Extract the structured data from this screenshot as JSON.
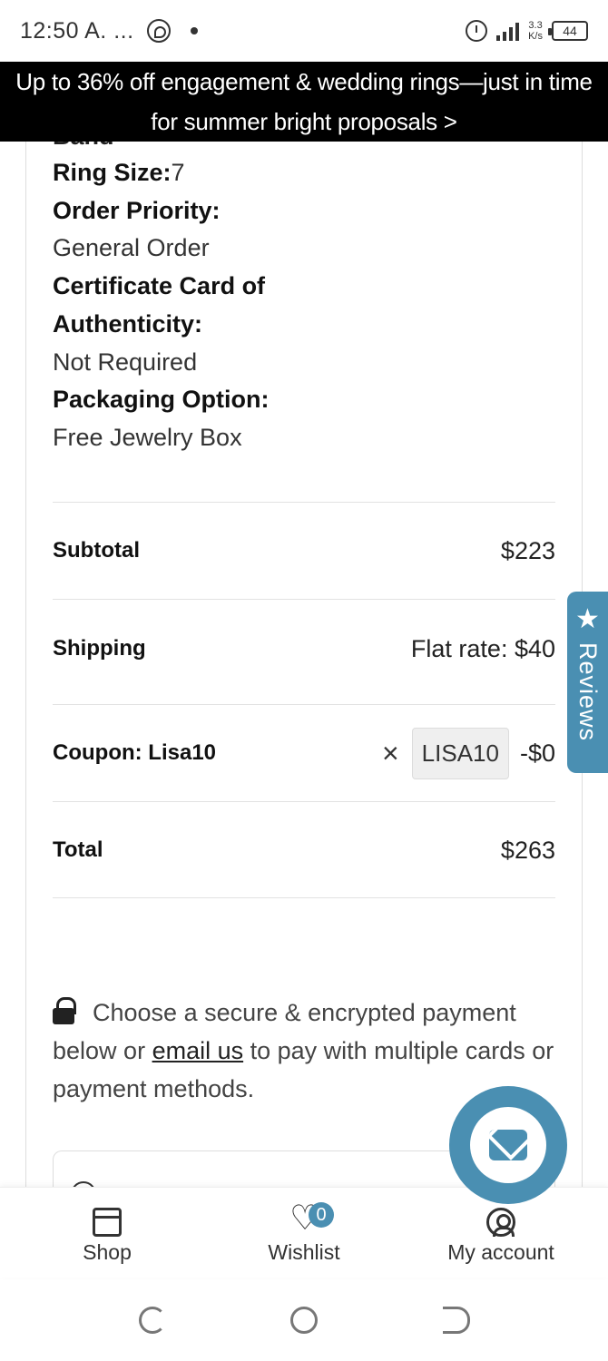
{
  "status_bar": {
    "time": "12:50 A. ...",
    "speed_value": "3.3",
    "speed_unit": "K/s",
    "battery": "44"
  },
  "promo": {
    "text": "Up to 36% off engagement & wedding rings—just in time for summer bright proposals >"
  },
  "order_details": {
    "clipped_text": "Band",
    "ring_size_label": "Ring Size:",
    "ring_size_value": "7",
    "priority_label": "Order Priority:",
    "priority_value": "General Order",
    "certificate_label": "Certificate Card of Authenticity:",
    "certificate_value": "Not Required",
    "packaging_label": "Packaging Option:",
    "packaging_value": "Free Jewelry Box"
  },
  "totals": {
    "subtotal_label": "Subtotal",
    "subtotal_value": "$223",
    "shipping_label": "Shipping",
    "shipping_value": "Flat rate: $40",
    "coupon_label": "Coupon: Lisa10",
    "coupon_remove": "×",
    "coupon_code": "LISA10",
    "coupon_value": "-$0",
    "total_label": "Total",
    "total_value": "$263"
  },
  "secure_note": {
    "text_before": "Choose a secure & encrypted payment below or ",
    "link": "email us",
    "text_after": " to pay with multiple cards or payment methods."
  },
  "reviews_tab": {
    "label": "Reviews",
    "icon": "star-icon"
  },
  "chat_button": {
    "icon": "envelope-icon"
  },
  "bottom_nav": {
    "shop": "Shop",
    "wishlist": "Wishlist",
    "wishlist_count": "0",
    "account": "My account"
  },
  "colors": {
    "accent": "#4a8fb2",
    "banner_bg": "#000000",
    "text": "#1a1a1a"
  }
}
